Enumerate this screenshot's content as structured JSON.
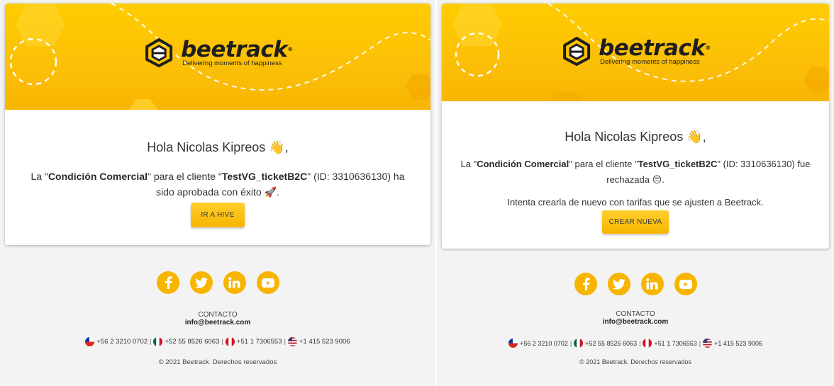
{
  "brand": {
    "name": "beetrack",
    "registered": "®",
    "tagline": "Delivering moments of happiness",
    "primary_color": "#f7b500"
  },
  "emails": {
    "approved": {
      "greeting": "Hola Nicolas Kipreos",
      "greeting_emoji": "👋",
      "greeting_suffix": ",",
      "msg_prefix": "La \"",
      "condition": "Condición Comercial",
      "msg_mid": "\" para el cliente \"",
      "client": "TestVG_ticketB2C",
      "msg_id": "\" (ID: 3310636130) ha sido aprobada con éxito ",
      "status_emoji": "🚀",
      "msg_end": ".",
      "button_label": "IR A HIVE"
    },
    "rejected": {
      "greeting": "Hola Nicolas Kipreos",
      "greeting_emoji": "👋",
      "greeting_suffix": ",",
      "msg_prefix": "La \"",
      "condition": "Condición Comercial",
      "msg_mid": "\" para el cliente \"",
      "client": "TestVG_ticketB2C",
      "msg_id": "\" (ID: 3310636130) fue rechazada ",
      "status_emoji": "😔",
      "msg_end": ".",
      "msg_retry": "Intenta crearla de nuevo con tarifas que se ajusten a Beetrack.",
      "button_label": "CREAR NUEVA"
    }
  },
  "footer": {
    "socials": [
      "facebook-icon",
      "twitter-icon",
      "linkedin-icon",
      "youtube-icon"
    ],
    "contact_title": "CONTACTO",
    "contact_email": "info@beetrack.com",
    "phones": {
      "chile": "+56 2 3210 0702",
      "mexico": "+52 55 8526 6063",
      "peru": "+51 1 7306553",
      "usa": "+1 415 523 9006"
    },
    "separator": "|",
    "copyright": "© 2021 Beetrack. Derechos reservados"
  }
}
